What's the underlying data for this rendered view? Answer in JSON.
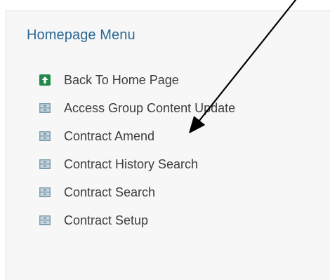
{
  "menu": {
    "title": "Homepage Menu",
    "items": [
      {
        "label": "Back To Home Page",
        "icon": "home-arrow-icon"
      },
      {
        "label": "Access Group Content Update",
        "icon": "drawer-icon"
      },
      {
        "label": "Contract Amend",
        "icon": "drawer-icon"
      },
      {
        "label": "Contract History Search",
        "icon": "drawer-icon"
      },
      {
        "label": "Contract Search",
        "icon": "drawer-icon"
      },
      {
        "label": "Contract Setup",
        "icon": "drawer-icon"
      }
    ]
  },
  "colors": {
    "title": "#2b6894",
    "home_icon": "#1f8a4c",
    "drawer_icon": "#7f9fb0",
    "annotation_arrow": "#000000"
  }
}
